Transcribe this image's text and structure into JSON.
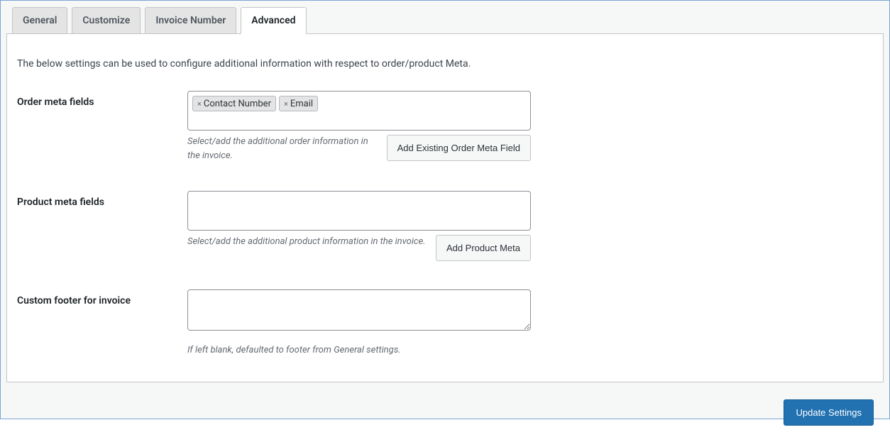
{
  "tabs": {
    "general": "General",
    "customize": "Customize",
    "invoice_number": "Invoice Number",
    "advanced": "Advanced"
  },
  "intro": "The below settings can be used to configure additional information with respect to order/product Meta.",
  "sections": {
    "order_meta": {
      "label": "Order meta fields",
      "tags": [
        "Contact Number",
        "Email"
      ],
      "help": "Select/add the additional order information in the invoice.",
      "button": "Add Existing Order Meta Field"
    },
    "product_meta": {
      "label": "Product meta fields",
      "tags": [],
      "help": "Select/add the additional product information in the invoice.",
      "button": "Add Product Meta"
    },
    "footer": {
      "label": "Custom footer for invoice",
      "value": "",
      "help": "If left blank, defaulted to footer from General settings."
    }
  },
  "actions": {
    "update": "Update Settings"
  }
}
